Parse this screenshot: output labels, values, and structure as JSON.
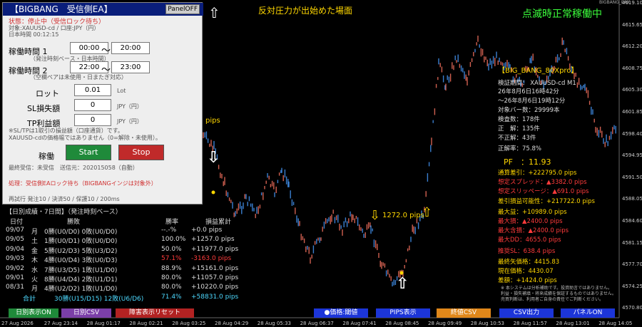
{
  "window": {
    "corner_label": "BIGBANG_EAX"
  },
  "header": {
    "center_text": "反対圧力が出始めた場面",
    "right_text": "点滅時正常稼働中"
  },
  "panel": {
    "title": "【BIGBANG　受信側EA】",
    "panel_off_button": "PanelOFF",
    "status": "状態：停止中（受信ロック待ち）",
    "target": "対象:XAUUSD-cd / 口座:JPY（円）",
    "jp_time": "日本時間 00:12:15",
    "time1_label": "稼働時間 1",
    "time1_start": "00:00",
    "time1_end": "20:00",
    "time1_note": "（発注時刻ベース・日本時間）",
    "time2_label": "稼働時間 2",
    "time2_start": "22:00",
    "time2_end": "23:00",
    "time2_note": "（空欄ペアは未使用・日またぎ対応）",
    "lot_label": "ロット",
    "lot_value": "0.01",
    "lot_unit": "Lot",
    "sl_label": "SL損失額",
    "sl_value": "0",
    "sl_unit": "JPY（円）",
    "tp_label": "TP利益額",
    "tp_value": "0",
    "tp_unit": "JPY（円）",
    "sltp_note1": "※SL/TPは1取引の損益額（口座通貨）です。",
    "sltp_note2": "XAUUSD-cdの価格幅ではありません（0=解除・未使用）。",
    "run_label": "稼働",
    "start_button": "Start",
    "stop_button": "Stop",
    "last_recv": "最終受信：未受信　送信元：202015058（自動）",
    "process": "処理：受信側EAロック待ち（BIGBANGインジは対象外）",
    "retry": "再試行 発注10 / 決済50 / 保護10 / 200ms"
  },
  "daily": {
    "title": "【日別成績・7日間】（発注時刻ベース）",
    "headers": [
      "日付",
      "勝敗",
      "勝率",
      "損益累計"
    ],
    "rows": [
      {
        "date": "09/07",
        "dow": "月",
        "wl": "0勝(U0/D0) 0敗(U0/D0)",
        "rate": "--.-%",
        "pips": "+0.0 pips",
        "color": "#dddddd"
      },
      {
        "date": "09/05",
        "dow": "土",
        "wl": "1勝(U0/D1) 0敗(U0/D0)",
        "rate": "100.0%",
        "pips": "+1257.0 pips",
        "color": "#dddddd"
      },
      {
        "date": "09/04",
        "dow": "金",
        "wl": "5勝(U2/D3) 5敗(U3/D2)",
        "rate": "50.0%",
        "pips": "+11977.0 pips",
        "color": "#dddddd"
      },
      {
        "date": "09/03",
        "dow": "木",
        "wl": "4勝(U0/D4) 3敗(U0/D3)",
        "rate": "57.1%",
        "pips": "-3163.0 pips",
        "color": "#ff3b3b"
      },
      {
        "date": "09/02",
        "dow": "水",
        "wl": "7勝(U3/D5) 1敗(U1/D0)",
        "rate": "88.9%",
        "pips": "+15161.0 pips",
        "color": "#dddddd"
      },
      {
        "date": "09/01",
        "dow": "火",
        "wl": "8勝(U4/D4) 2敗(U1/D1)",
        "rate": "80.0%",
        "pips": "+11057.0 pips",
        "color": "#dddddd"
      },
      {
        "date": "08/31",
        "dow": "月",
        "wl": "4勝(U2/D2) 1敗(U1/D0)",
        "rate": "80.0%",
        "pips": "+10220.0 pips",
        "color": "#dddddd"
      }
    ],
    "total": {
      "label": "合計",
      "wl": "30勝(U15/D15) 12敗(U6/D6)",
      "rate": "71.4%",
      "pips": "+58831.0 pips"
    }
  },
  "bottom_buttons_left": [
    {
      "label": "日別表示ON",
      "color": "#1f8a3a"
    },
    {
      "label": "日別CSV",
      "color": "#7b3fa8"
    },
    {
      "label": "障害表示リセット",
      "color": "#b22222"
    }
  ],
  "bottom_buttons_right": [
    {
      "label": "●価格:閾値",
      "color": "#1c35d8"
    },
    {
      "label": "PIPS表示",
      "color": "#1c35d8"
    },
    {
      "label": "終値CSV",
      "color": "#e0871a"
    },
    {
      "label": "CSV出力",
      "color": "#1c35d8"
    },
    {
      "label": "パネルON",
      "color": "#1c35d8"
    }
  ],
  "stats": {
    "title": "【BIG_BANG_80Xpro】",
    "period_label": "検証期間： XAUUSD-cd M1",
    "period_from": "26年8月6日16時42分",
    "period_to": "〜26年8月6日19時12分",
    "bars": "対象バー数：29999本",
    "count": "検査数：178件",
    "correct": "正　解：135件",
    "wrong": "不正解：43件",
    "rate": "正解率：75.8%",
    "pf": "PF　：11.93",
    "total": "通算差引：+222795.0 pips",
    "spread": "想定スプレッド：▲3382.0 pips",
    "slip": "想定スリッページ：▲691.0 pips",
    "net": "差引損益可能性：+217722.0 pips",
    "max_profit": "最大益：+10989.0 pips",
    "max_loss": "最大損：▲2400.0 pips",
    "max_cont_loss": "最大含損：▲2400.0 pips",
    "max_dd": "最大DD：4655.0 pips",
    "recommended_sl": "推奨SL：638.4 pips",
    "final_price": "最終矢価格：4415.83",
    "current_price": "現在価格：4430.07",
    "diff": "差額：+1424.0 pips",
    "disclaimer1": "※ 本システムは分析補助です。投資助言ではありません。",
    "disclaimer2": "利益・損失補填・将来成績を保証するものではありません。",
    "disclaimer3": "売買判断は、利用者ご自身の責任でご判断ください。"
  },
  "annotations": {
    "pips_label": "pips",
    "signal_label": "1272.0 pips"
  },
  "y_axis": [
    "4619.10",
    "4615.65",
    "4612.20",
    "4608.75",
    "4605.30",
    "4601.85",
    "4598.40",
    "4594.95",
    "4591.50",
    "4588.05",
    "4584.60",
    "4581.15",
    "4577.70",
    "4574.25",
    "4570.80"
  ],
  "x_axis": [
    "27 Aug 2026",
    "27 Aug 23:14",
    "28 Aug 01:17",
    "28 Aug 02:21",
    "28 Aug 03:25",
    "28 Aug 04:29",
    "28 Aug 05:33",
    "28 Aug 06:37",
    "28 Aug 07:41",
    "28 Aug 08:45",
    "28 Aug 09:49",
    "28 Aug 10:53",
    "28 Aug 11:57",
    "28 Aug 13:01",
    "28 Aug 14:05"
  ]
}
